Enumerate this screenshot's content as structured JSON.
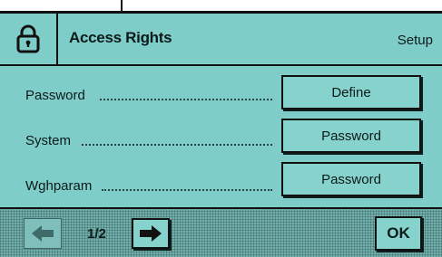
{
  "header": {
    "title": "Access Rights",
    "context_label": "Setup",
    "icon": "padlock-icon"
  },
  "rows": [
    {
      "label": "Password",
      "button_label": "Define"
    },
    {
      "label": "System",
      "button_label": "Password"
    },
    {
      "label": "Wghparam",
      "button_label": "Password"
    }
  ],
  "footer": {
    "page_indicator": "1/2",
    "prev_icon": "arrow-left-icon",
    "next_icon": "arrow-right-icon",
    "ok_label": "OK"
  },
  "colors": {
    "lcd_background": "#7fcdc8",
    "button_background": "#86d3ce",
    "footer_background": "#6fb0ac",
    "ink": "#0c1a1a"
  }
}
